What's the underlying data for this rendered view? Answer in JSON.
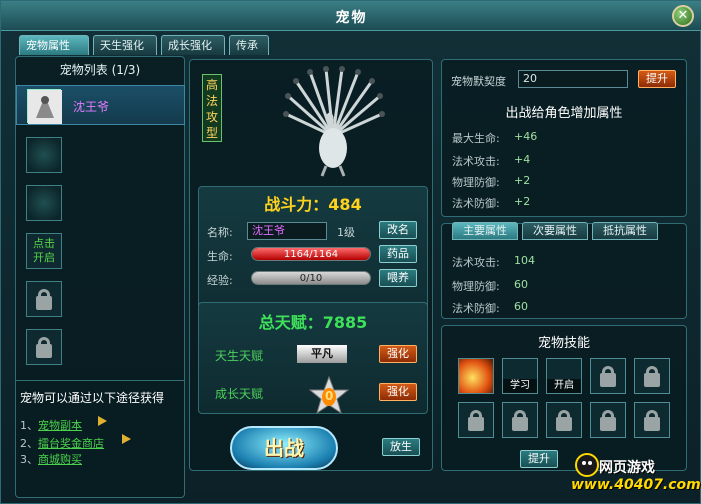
{
  "window": {
    "title": "宠物"
  },
  "tabs": [
    {
      "label": "宠物属性"
    },
    {
      "label": "天生强化"
    },
    {
      "label": "成长强化"
    },
    {
      "label": "传承"
    }
  ],
  "pet_list": {
    "title": "宠物列表 (1/3)",
    "selected_pet_name": "沈王爷",
    "unlock_label": "点击\n开启",
    "source_title": "宠物可以通过以下途径获得",
    "sources": [
      {
        "num": "1、",
        "link": "宠物副本"
      },
      {
        "num": "2、",
        "link": "擂台奖金商店"
      },
      {
        "num": "3、",
        "link": "商城购买"
      }
    ]
  },
  "pet_detail": {
    "type_badge": "高\n法\n攻\n型",
    "power_label": "战斗力：484",
    "name_label": "名称:",
    "name_value": "沈王爷",
    "level": "1级",
    "rename_button": "改名",
    "hp_label": "生命:",
    "hp_text": "1164/1164",
    "hp_fraction": 1.0,
    "medicine_button": "药品",
    "exp_label": "经验:",
    "exp_text": "0/10",
    "exp_fraction": 0.0,
    "feed_button": "喂养",
    "talent_title": "总天赋：7885",
    "innate_talent_label": "天生天赋",
    "innate_grade": "平凡",
    "growth_talent_label": "成长天赋",
    "growth_value": "0",
    "strengthen_button": "强化",
    "fight_button": "出战",
    "release_button": "放生"
  },
  "bonus": {
    "affinity_label": "宠物默契度",
    "affinity_value": "20",
    "upgrade_button": "提升",
    "section_title": "出战给角色增加属性",
    "stats": [
      {
        "name": "最大生命:",
        "value": "+46"
      },
      {
        "name": "法术攻击:",
        "value": "+4"
      },
      {
        "name": "物理防御:",
        "value": "+2"
      },
      {
        "name": "法术防御:",
        "value": "+2"
      }
    ]
  },
  "attributes": {
    "subtabs": [
      {
        "label": "主要属性"
      },
      {
        "label": "次要属性"
      },
      {
        "label": "抵抗属性"
      }
    ],
    "stats": [
      {
        "name": "法术攻击:",
        "value": "104"
      },
      {
        "name": "物理防御:",
        "value": "60"
      },
      {
        "name": "法术防御:",
        "value": "60"
      }
    ]
  },
  "skills": {
    "title": "宠物技能",
    "learn_label": "学习",
    "open_label": "开启",
    "upgrade_button": "提升"
  },
  "watermark": {
    "text": "网页游戏",
    "url": "www.40407.com"
  },
  "colors": {
    "accent": "#2b7a81",
    "gold": "#ffd21e",
    "green": "#3fe05a",
    "pet_name": "#e47cff"
  }
}
